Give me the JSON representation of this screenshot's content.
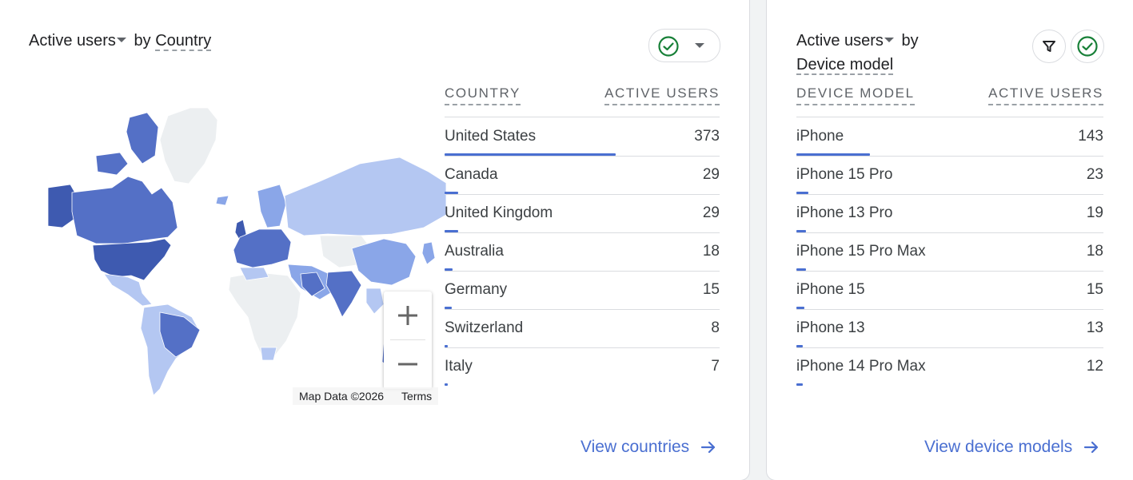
{
  "country_card": {
    "title_metric": "Active users",
    "title_by": "by",
    "title_dimension": "Country",
    "col_dimension": "COUNTRY",
    "col_metric": "ACTIVE USERS",
    "rows": [
      {
        "name": "United States",
        "value": "373",
        "share": 1.0
      },
      {
        "name": "Canada",
        "value": "29",
        "share": 0.078
      },
      {
        "name": "United Kingdom",
        "value": "29",
        "share": 0.078
      },
      {
        "name": "Australia",
        "value": "18",
        "share": 0.048
      },
      {
        "name": "Germany",
        "value": "15",
        "share": 0.04
      },
      {
        "name": "Switzerland",
        "value": "8",
        "share": 0.021
      },
      {
        "name": "Italy",
        "value": "7",
        "share": 0.019
      }
    ],
    "map_attribution": "Map Data ©2026",
    "map_terms": "Terms",
    "view_link": "View countries"
  },
  "device_card": {
    "title_metric": "Active users",
    "title_by": "by",
    "title_dimension": "Device model",
    "col_dimension": "DEVICE MODEL",
    "col_metric": "ACTIVE USERS",
    "rows": [
      {
        "name": "iPhone",
        "value": "143",
        "share": 1.0
      },
      {
        "name": "iPhone 15 Pro",
        "value": "23",
        "share": 0.161
      },
      {
        "name": "iPhone 13 Pro",
        "value": "19",
        "share": 0.133
      },
      {
        "name": "iPhone 15 Pro Max",
        "value": "18",
        "share": 0.126
      },
      {
        "name": "iPhone 15",
        "value": "15",
        "share": 0.105
      },
      {
        "name": "iPhone 13",
        "value": "13",
        "share": 0.091
      },
      {
        "name": "iPhone 14 Pro Max",
        "value": "12",
        "share": 0.084
      }
    ],
    "view_link": "View device models"
  },
  "icons": {
    "check": "check-circle-icon",
    "dropdown": "dropdown-caret-icon",
    "filter": "filter-icon",
    "arrow": "arrow-right-icon",
    "zoom_in": "zoom-in-icon",
    "zoom_out": "zoom-out-icon"
  },
  "colors": {
    "accent": "#4a6fd1",
    "check_green": "#188038",
    "map_high": "#5470c6",
    "map_mid": "#8aa6e8",
    "map_low": "#b4c7f2",
    "map_none": "#eceff1"
  }
}
